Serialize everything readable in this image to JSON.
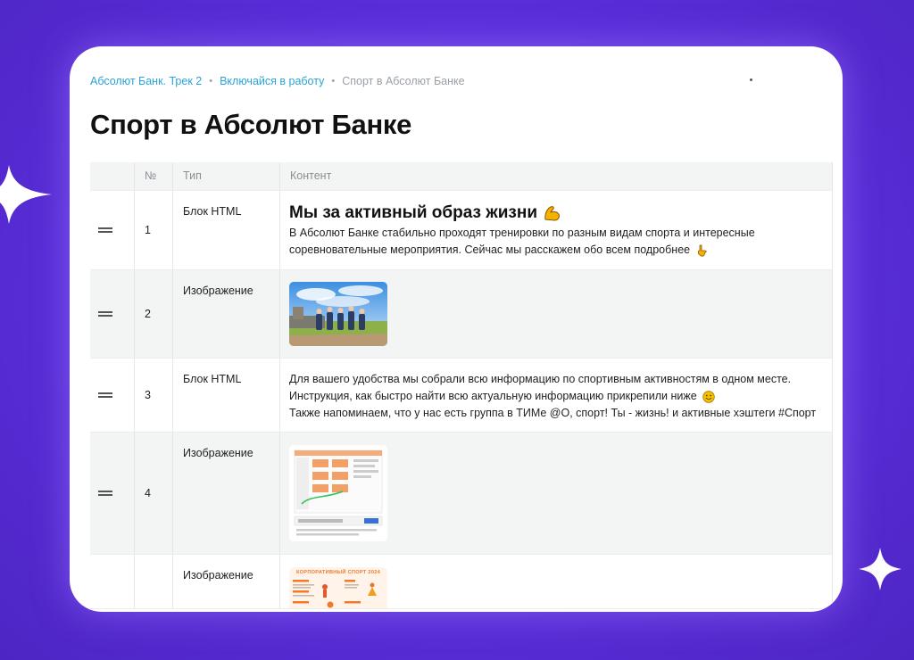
{
  "breadcrumb": {
    "items": [
      {
        "label": "Абсолют Банк. Трек 2",
        "link": true
      },
      {
        "label": "Включайся в работу",
        "link": true
      },
      {
        "label": "Спорт в Абсолют Банке",
        "link": false
      }
    ],
    "separator": "•"
  },
  "page": {
    "title": "Спорт в Абсолют Банке"
  },
  "table": {
    "columns": [
      "№",
      "Тип",
      "Контент"
    ],
    "rows": [
      {
        "num": "1",
        "type": "Блок HTML",
        "heading": "Мы за активный образ жизни",
        "text": "В Абсолют Банке стабильно проходят тренировки по разным видам спорта и интересные соревновательные мероприятия. Сейчас мы расскажем обо всем подробнее"
      },
      {
        "num": "2",
        "type": "Изображение"
      },
      {
        "num": "3",
        "type": "Блок HTML",
        "lines": [
          "Для вашего удобства мы собрали всю информацию по спортивным активностям в одном месте.",
          "Инструкция, как быстро найти всю актуальную информацию прикрепили ниже",
          "Также напоминаем, что у нас есть группа в ТИМе @O, спорт! Ты - жизнь! и активные хэштеги #Спорт"
        ]
      },
      {
        "num": "4",
        "type": "Изображение"
      },
      {
        "num": "",
        "type": "Изображение",
        "image_caption": "КОРПОРАТИВНЫЙ СПОРТ 2024"
      }
    ]
  },
  "icons": {
    "drag": "drag-handle-icon",
    "muscle": "flexed-biceps-icon",
    "point_down": "pointing-down-icon",
    "smile": "smile-icon"
  },
  "colors": {
    "frame": "#5a2fd8",
    "link": "#2aa3d8",
    "accent_orange": "#f07a2a"
  }
}
